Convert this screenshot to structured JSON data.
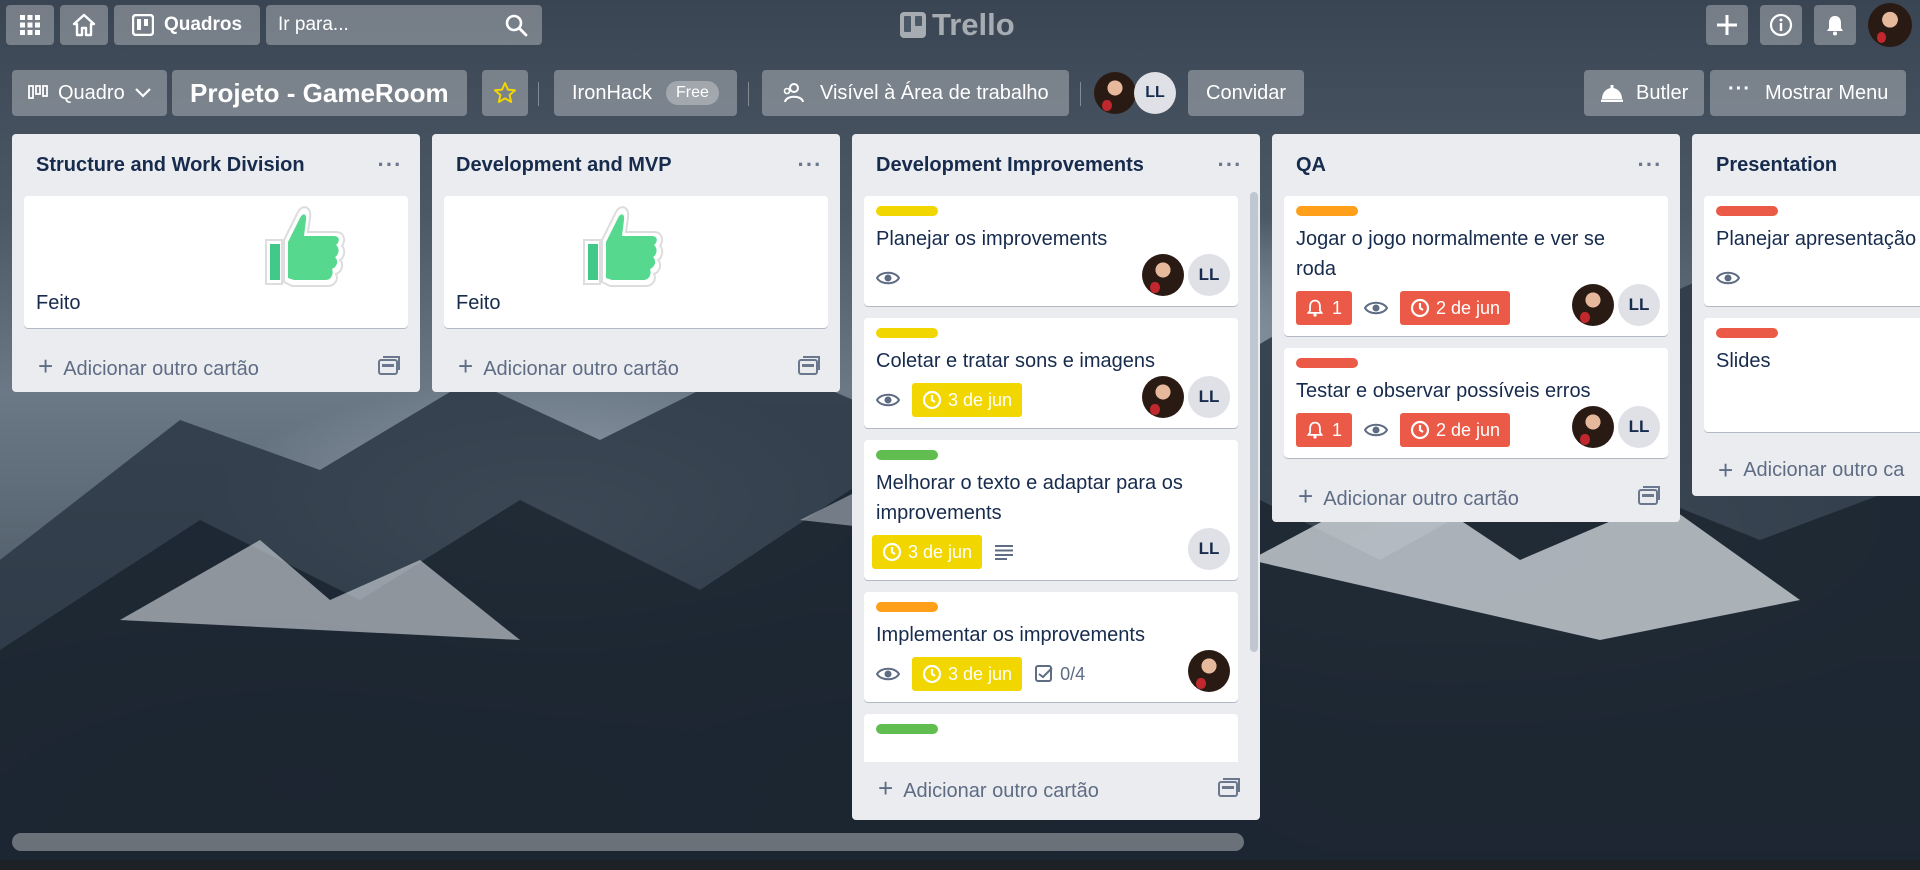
{
  "header": {
    "apps_icon": "apps-grid-icon",
    "home_icon": "home-icon",
    "boards_label": "Quadros",
    "search_placeholder": "Ir para...",
    "logo_text": "Trello",
    "create_icon": "plus-icon",
    "info_icon": "info-icon",
    "notifications_icon": "bell-icon"
  },
  "board": {
    "view_label": "Quadro",
    "title": "Projeto - GameRoom",
    "workspace_label": "IronHack",
    "workspace_badge": "Free",
    "visibility_label": "Visível à Área de trabalho",
    "member_initials": "LL",
    "invite_label": "Convidar",
    "butler_label": "Butler",
    "menu_label": "Mostrar Menu"
  },
  "colors": {
    "yellow": "#f2d600",
    "green": "#61bd4f",
    "orange": "#ff9f1a",
    "red": "#eb5a46"
  },
  "add_card_label": "Adicionar outro cartão",
  "lists": [
    {
      "title": "Structure and Work Division",
      "cards": [
        {
          "title": "Feito",
          "cover": "thumbs-up-sticker"
        }
      ]
    },
    {
      "title": "Development and MVP",
      "cards": [
        {
          "title": "Feito",
          "cover": "thumbs-up-sticker"
        }
      ]
    },
    {
      "title": "Development Improvements",
      "cards": [
        {
          "label_color": "yellow",
          "title": "Planejar os improvements",
          "watch": true,
          "members": [
            "photo",
            "LL"
          ]
        },
        {
          "label_color": "yellow",
          "title": "Coletar e tratar sons e imagens",
          "watch": true,
          "due": "3 de jun",
          "members": [
            "photo",
            "LL"
          ]
        },
        {
          "label_color": "green",
          "title": "Melhorar o texto e adaptar para os improvements",
          "due": "3 de jun",
          "description": true,
          "members": [
            "LL"
          ]
        },
        {
          "label_color": "orange",
          "title": "Implementar os improvements",
          "watch": true,
          "due": "3 de jun",
          "checklist": "0/4",
          "members": [
            "photo"
          ]
        },
        {
          "label_color": "green",
          "title": ""
        }
      ]
    },
    {
      "title": "QA",
      "cards": [
        {
          "label_color": "orange",
          "title": "Jogar o jogo normalmente e ver se roda",
          "notifications": "1",
          "watch": true,
          "due": "2 de jun",
          "members": [
            "photo",
            "LL"
          ]
        },
        {
          "label_color": "red",
          "title": "Testar e observar possíveis erros",
          "notifications": "1",
          "watch": true,
          "due": "2 de jun",
          "members": [
            "photo",
            "LL"
          ]
        }
      ]
    },
    {
      "title": "Presentation",
      "cards": [
        {
          "label_color": "red",
          "title": "Planejar apresentação",
          "watch": true
        },
        {
          "label_color": "red",
          "title": "Slides"
        }
      ],
      "add_card_label": "Adicionar outro ca"
    }
  ]
}
